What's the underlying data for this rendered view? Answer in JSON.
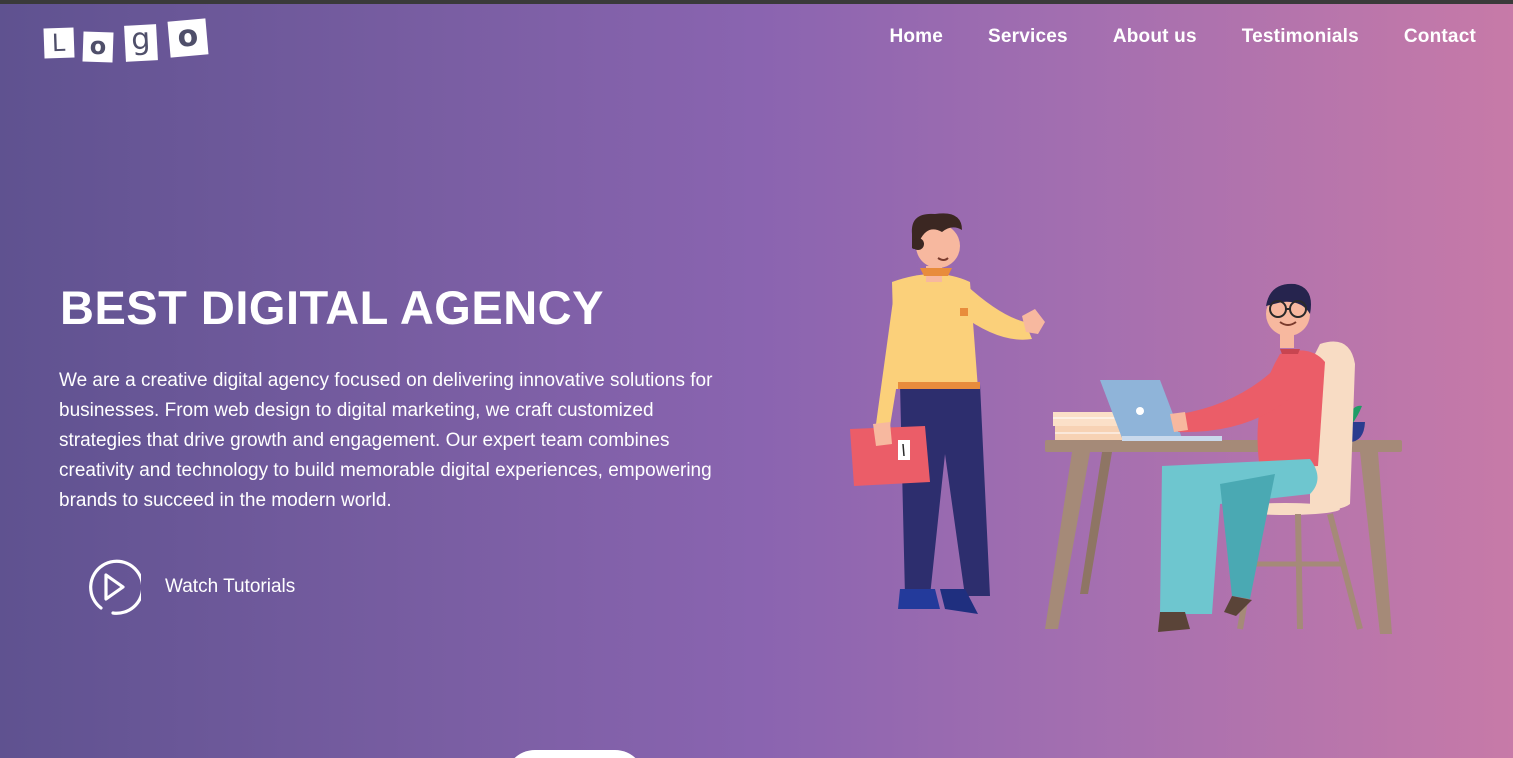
{
  "logo": {
    "letters": [
      "L",
      "o",
      "g",
      "o"
    ]
  },
  "nav": {
    "items": [
      {
        "label": "Home"
      },
      {
        "label": "Services"
      },
      {
        "label": "About us"
      },
      {
        "label": "Testimonials"
      },
      {
        "label": "Contact"
      }
    ]
  },
  "hero": {
    "title": "BEST DIGITAL AGENCY",
    "description": "We are a creative digital agency focused on delivering innovative solutions for businesses. From web design to digital marketing, we craft customized strategies that drive growth and engagement. Our expert team combines creativity and technology to build memorable digital experiences, empowering brands to succeed in the modern world.",
    "cta_label": "Watch Tutorials",
    "cta_icon": "play-circle-icon",
    "illustration": "office-team-illustration"
  },
  "colors": {
    "gradient_start": "#5f5290",
    "gradient_mid": "#8a64b0",
    "gradient_end": "#c77aa8",
    "text": "#ffffff"
  }
}
